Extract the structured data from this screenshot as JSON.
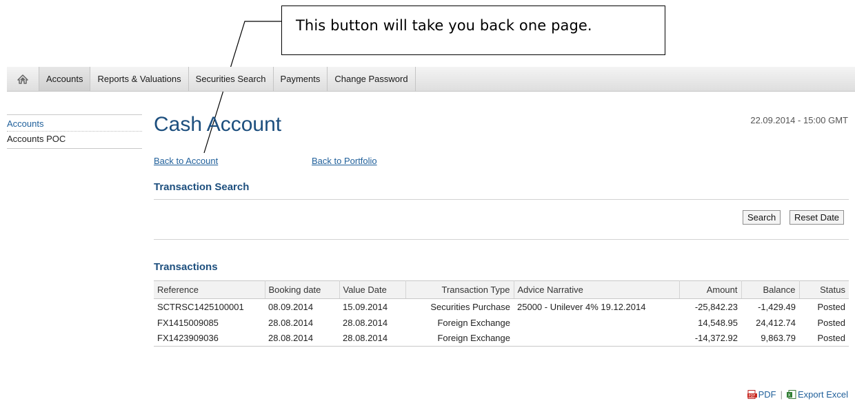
{
  "callout": {
    "text": "This button will take you back one page."
  },
  "nav": {
    "home_icon": "home-icon",
    "items": [
      "Accounts",
      "Reports & Valuations",
      "Securities Search",
      "Payments",
      "Change Password"
    ],
    "active": "Accounts"
  },
  "sidebar": {
    "items": [
      "Accounts",
      "Accounts POC"
    ]
  },
  "page": {
    "title": "Cash Account",
    "timestamp": "22.09.2014 - 15:00  GMT",
    "back_to_account": "Back to Account",
    "back_to_portfolio": "Back to Portfolio"
  },
  "search": {
    "heading": "Transaction Search",
    "search_button": "Search",
    "reset_button": "Reset Date"
  },
  "transactions": {
    "heading": "Transactions",
    "columns": [
      "Reference",
      "Booking date",
      "Value Date",
      "Transaction Type",
      "Advice Narrative",
      "Amount",
      "Balance",
      "Status"
    ],
    "rows": [
      [
        "SCTRSC1425100001",
        "08.09.2014",
        "15.09.2014",
        "Securities Purchase",
        "25000 - Unilever 4% 19.12.2014",
        "-25,842.23",
        "-1,429.49",
        "Posted"
      ],
      [
        "FX1415009085",
        "28.08.2014",
        "28.08.2014",
        "Foreign Exchange",
        "",
        "14,548.95",
        "24,412.74",
        "Posted"
      ],
      [
        "FX1423909036",
        "28.08.2014",
        "28.08.2014",
        "Foreign Exchange",
        "",
        "-14,372.92",
        "9,863.79",
        "Posted"
      ]
    ]
  },
  "exports": {
    "pdf": "PDF",
    "separator": "|",
    "excel": "Export Excel"
  },
  "colors": {
    "link": "#1f5f9a",
    "heading": "#1d4f7e"
  }
}
